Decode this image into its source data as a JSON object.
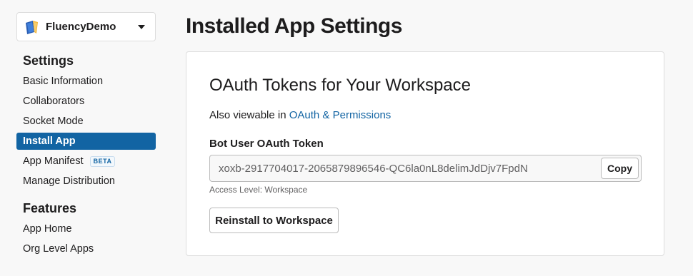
{
  "app_switcher": {
    "name": "FluencyDemo",
    "icon": "book-icon"
  },
  "sidebar": {
    "settings_title": "Settings",
    "settings_items": [
      {
        "label": "Basic Information"
      },
      {
        "label": "Collaborators"
      },
      {
        "label": "Socket Mode"
      },
      {
        "label": "Install App",
        "active": true
      },
      {
        "label": "App Manifest",
        "badge": "BETA"
      },
      {
        "label": "Manage Distribution"
      }
    ],
    "features_title": "Features",
    "features_items": [
      {
        "label": "App Home"
      },
      {
        "label": "Org Level Apps"
      }
    ]
  },
  "page": {
    "title": "Installed App Settings"
  },
  "oauth_card": {
    "title": "OAuth Tokens for Your Workspace",
    "also_prefix": "Also viewable in",
    "also_link": "OAuth & Permissions",
    "token_label": "Bot User OAuth Token",
    "token_value": "xoxb-2917704017-2065879896546-QC6la0nL8delimJdDjv7FpdN",
    "copy_label": "Copy",
    "access_level": "Access Level: Workspace",
    "reinstall_label": "Reinstall to Workspace"
  },
  "colors": {
    "accent": "#1264a3",
    "background": "#f8f8f8",
    "text": "#1d1c1d",
    "muted": "#616061"
  }
}
